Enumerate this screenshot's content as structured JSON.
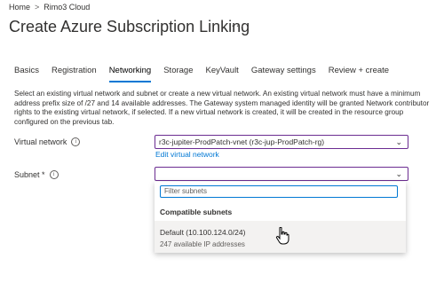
{
  "breadcrumb": {
    "items": [
      "Home",
      "Rimo3 Cloud"
    ],
    "separator": ">"
  },
  "page": {
    "title": "Create Azure Subscription Linking",
    "more": "···"
  },
  "tabs": [
    {
      "label": "Basics",
      "active": false
    },
    {
      "label": "Registration",
      "active": false
    },
    {
      "label": "Networking",
      "active": true
    },
    {
      "label": "Storage",
      "active": false
    },
    {
      "label": "KeyVault",
      "active": false
    },
    {
      "label": "Gateway settings",
      "active": false
    },
    {
      "label": "Review + create",
      "active": false
    }
  ],
  "description": "Select an existing virtual network and subnet or create a new virtual network. An existing virtual network must have a minimum address prefix size of /27 and 14 available addresses. The Gateway system managed identity will be granted Network contributor rights to the existing virtual network, if selected. If a new virtual network is created, it will be created in the resource group configured on the previous tab.",
  "virtual_network": {
    "label": "Virtual network",
    "value": "r3c-jupiter-ProdPatch-vnet (r3c-jup-ProdPatch-rg)",
    "edit_link": "Edit virtual network"
  },
  "subnet": {
    "label": "Subnet *",
    "value": "",
    "dropdown": {
      "filter_placeholder": "Filter subnets",
      "group_heading": "Compatible subnets",
      "options": [
        {
          "name": "Default (10.100.124.0/24)",
          "detail": "247 available IP addresses"
        }
      ]
    }
  },
  "colors": {
    "accent": "#0078d4",
    "focus_border": "#6b2c91",
    "hover_bg": "#f3f2f1"
  }
}
